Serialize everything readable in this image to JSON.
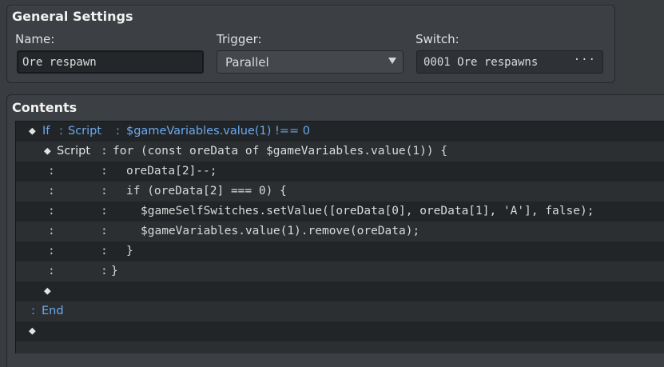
{
  "general": {
    "title": "General Settings",
    "name_label": "Name:",
    "name_value": "Ore respawn",
    "trigger_label": "Trigger:",
    "trigger_value": "Parallel",
    "switch_label": "Switch:",
    "switch_value": "0001 Ore respawns",
    "switch_more": "···"
  },
  "contents": {
    "title": "Contents",
    "rows": [
      {
        "marker": "◆",
        "text": "If",
        "colon1": ":",
        "text2": "Script",
        "colon2": ":",
        "code": "$gameVariables.value(1) !== 0"
      },
      {
        "marker": "◆",
        "text": "Script",
        "colon": ":",
        "code": "for (const oreData of $gameVariables.value(1)) {"
      },
      {
        "c1": ":",
        "c2": ":",
        "code": "oreData[2]--;"
      },
      {
        "c1": ":",
        "c2": ":",
        "code": "if (oreData[2] === 0) {"
      },
      {
        "c1": ":",
        "c2": ":",
        "code": "$gameSelfSwitches.setValue([oreData[0], oreData[1], 'A'], false);"
      },
      {
        "c1": ":",
        "c2": ":",
        "code": "$gameVariables.value(1).remove(oreData);"
      },
      {
        "c1": ":",
        "c2": ":",
        "code": "}"
      },
      {
        "c1": ":",
        "c2": ":",
        "code": "}"
      },
      {
        "marker": "◆"
      },
      {
        "colon": ":",
        "text": "End"
      },
      {
        "marker": "◆"
      },
      {}
    ]
  },
  "colors": {
    "keyword": "#6aa9f0",
    "background": "#3a3d40",
    "list_background": "#222527"
  }
}
